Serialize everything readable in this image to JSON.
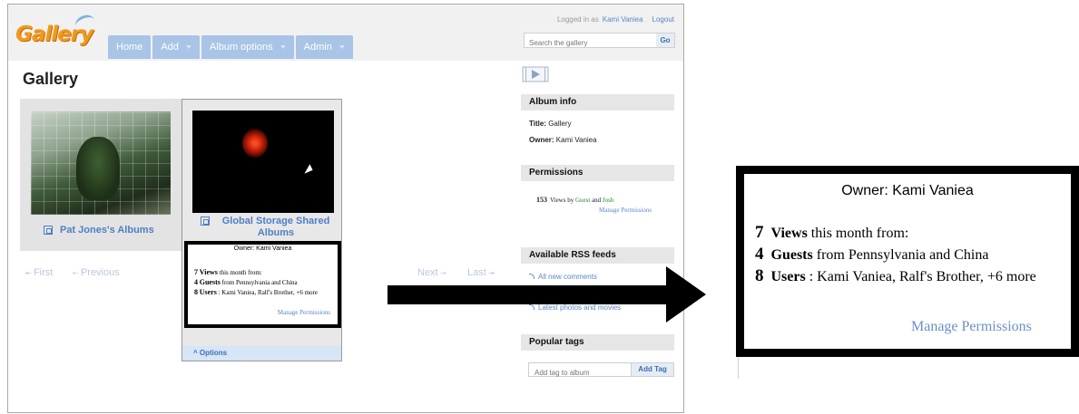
{
  "app": {
    "logo_text": "Gallery"
  },
  "header": {
    "nav": [
      "Home",
      "Add",
      "Album options",
      "Admin"
    ],
    "logged_in_prefix": "Logged in as",
    "user_name": "Kami Vaniea",
    "logout": "Logout",
    "search_placeholder": "Search the gallery",
    "search_button": "Go"
  },
  "main": {
    "title": "Gallery",
    "albums": [
      {
        "title": "Pat Jones's Albums"
      },
      {
        "title": "Global Storage Shared Albums"
      }
    ],
    "options_label": "Options",
    "pager": {
      "first": "First",
      "previous": "Previous",
      "next": "Next",
      "last": "Last"
    }
  },
  "popup": {
    "owner": "Owner: Kami Vaniea",
    "views_count": "7",
    "views_label": "Views",
    "views_rest": "this month from:",
    "guests_count": "4",
    "guests_label": "Guests",
    "guests_rest": "from Pennsylvania and China",
    "users_count": "8",
    "users_label": "Users",
    "users_rest": ": Kami Vaniea, Ralf's Brother, +6 more",
    "manage": "Manage Permissions"
  },
  "sidebar": {
    "album_info_header": "Album info",
    "title_label": "Title:",
    "title_value": "Gallery",
    "owner_label": "Owner:",
    "owner_value": "Kami Vaniea",
    "permissions_header": "Permissions",
    "perm_count": "153",
    "perm_text": "Views by",
    "perm_guest": "Guest",
    "perm_and": "and",
    "perm_josh": "Josh",
    "perm_manage": "Manage Permissions",
    "rss_header": "Available RSS feeds",
    "rss_items": [
      "All new comments",
      "Latest photos and movies"
    ],
    "tags_header": "Popular tags",
    "tag_placeholder": "Add tag to album",
    "tag_button": "Add Tag"
  },
  "colors": {
    "accent": "#5b86c4",
    "nav_bg": "#a8c4e6",
    "logo": "#ef9a1e"
  }
}
